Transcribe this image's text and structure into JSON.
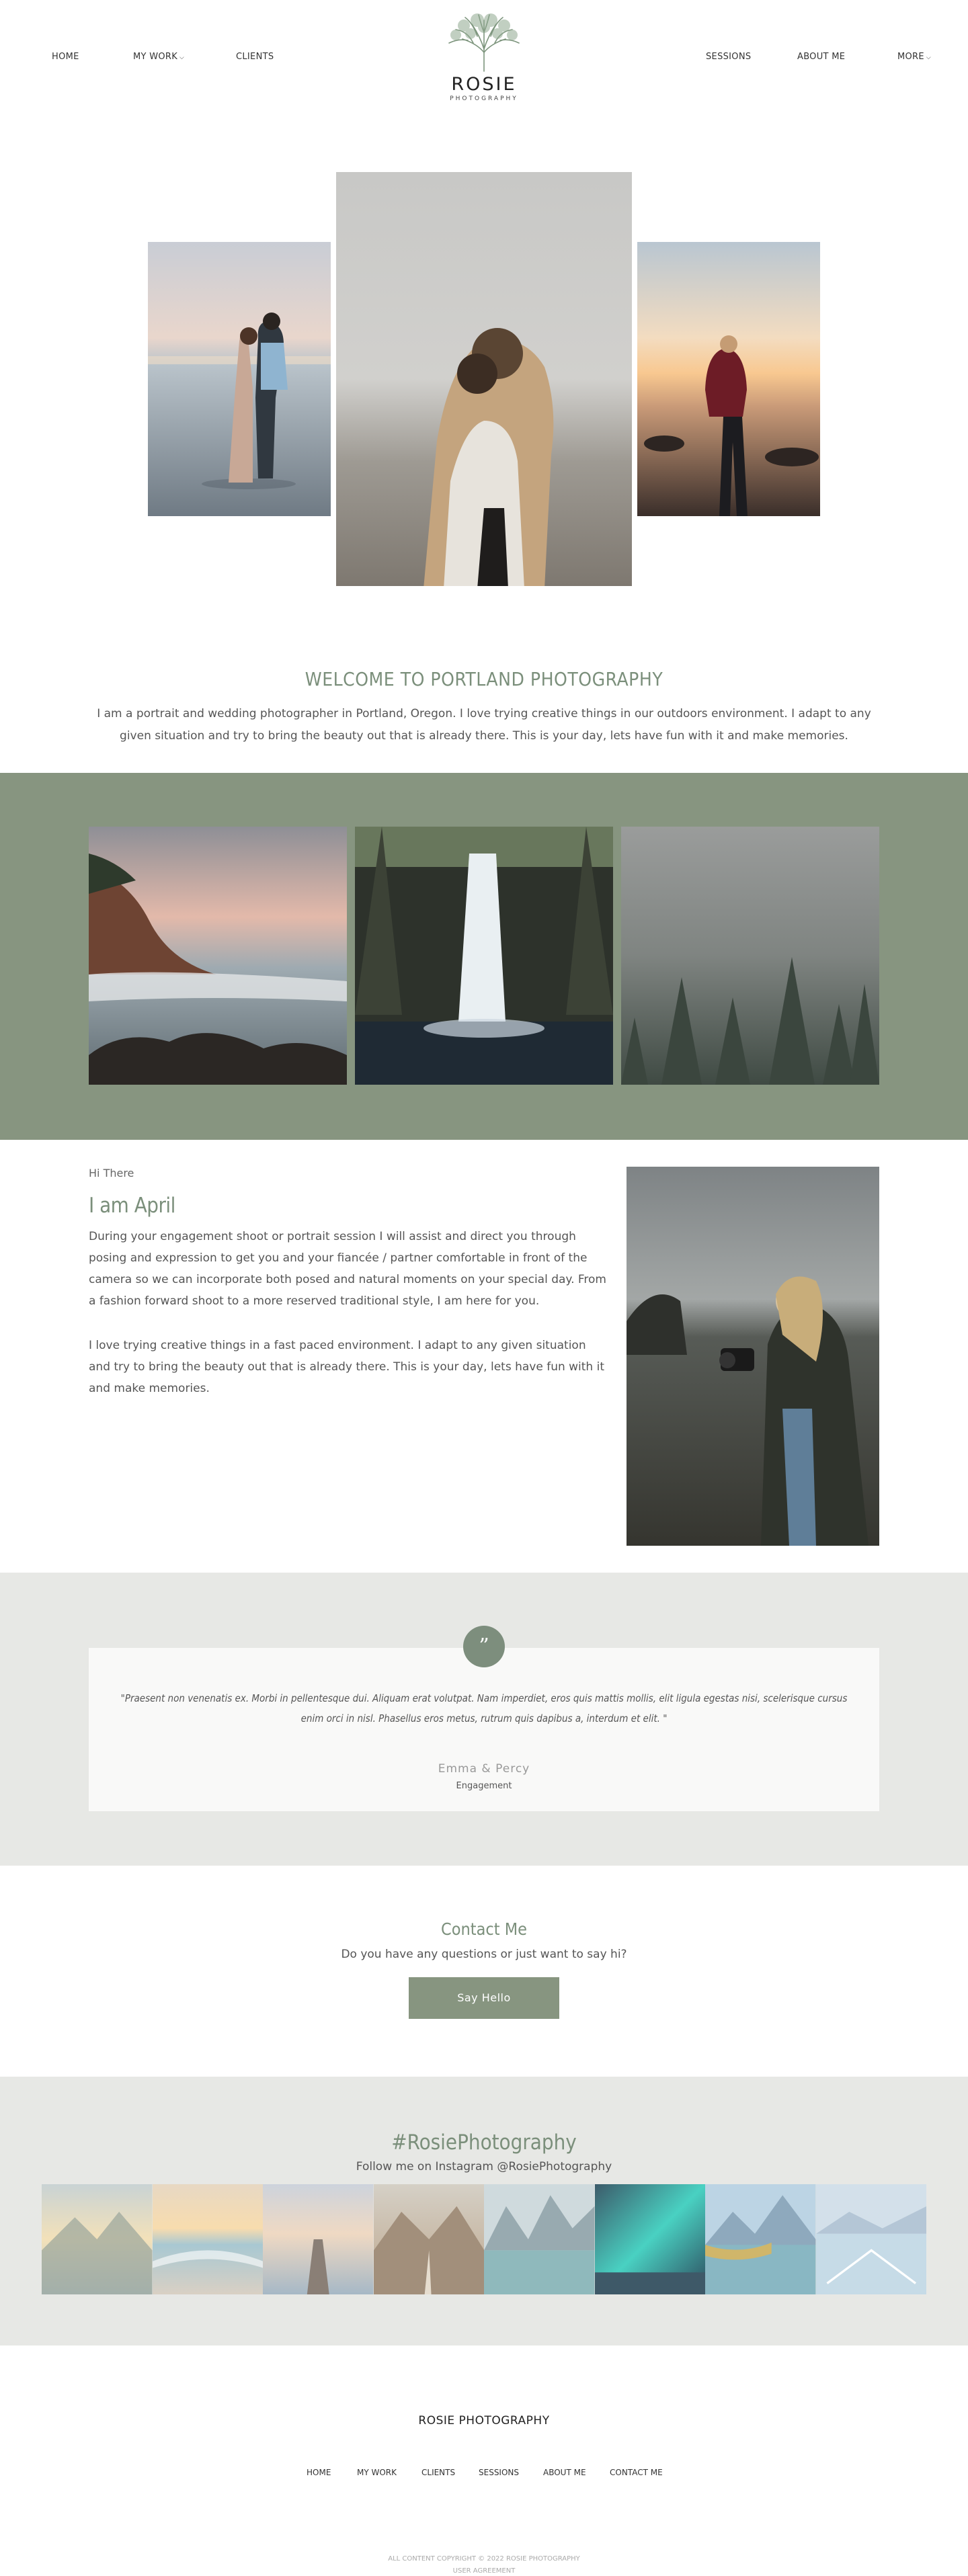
{
  "header": {
    "nav_left": [
      {
        "label": "HOME",
        "caret": false
      },
      {
        "label": "MY WORK",
        "caret": true
      },
      {
        "label": "CLIENTS",
        "caret": false
      }
    ],
    "nav_right": [
      {
        "label": "SESSIONS",
        "caret": false
      },
      {
        "label": "ABOUT ME",
        "caret": false
      },
      {
        "label": "MORE",
        "caret": true
      }
    ],
    "logo_title": "ROSIE",
    "logo_subtitle": "PHOTOGRAPHY"
  },
  "welcome": {
    "title": "WELCOME TO PORTLAND PHOTOGRAPHY",
    "text": "I am a portrait and wedding photographer in Portland, Oregon. I love trying creative things in our outdoors environment. I adapt to any given situation and try to bring the beauty out that is already there. This is your day, lets have fun with it and make memories."
  },
  "about": {
    "greeting": "Hi There",
    "title": "I am April",
    "paragraph1": "During your engagement shoot or portrait session I will assist and direct you through posing and expression to get you and your fiancée / partner comfortable in front of the camera so we can incorporate both posed and natural moments on your special day. From a fashion forward shoot to a more reserved traditional style, I am here for you.",
    "paragraph2": "I love trying creative things in a fast paced environment. I adapt to any given situation and try to bring the beauty out that is already there. This is your day, lets have fun with it and make memories."
  },
  "testimonial": {
    "quote": "\"Praesent non venenatis ex. Morbi in pellentesque dui. Aliquam erat volutpat. Nam imperdiet, eros quis mattis mollis, elit ligula egestas nisi, scelerisque cursus enim orci in nisl. Phasellus eros metus, rutrum quis dapibus a, interdum et elit. \"",
    "name": "Emma & Percy",
    "role": "Engagement",
    "icon": "quote-icon"
  },
  "contact": {
    "title": "Contact Me",
    "text": "Do you have any questions or just want to say hi?",
    "button": "Say Hello"
  },
  "instagram": {
    "title": "#RosiePhotography",
    "text": "Follow me on Instagram @RosiePhotography"
  },
  "footer": {
    "brand": "ROSIE PHOTOGRAPHY",
    "nav": [
      "HOME",
      "MY WORK",
      "CLIENTS",
      "SESSIONS",
      "ABOUT ME",
      "CONTACT ME"
    ],
    "copyright": "ALL CONTENT COPYRIGHT © 2022 ROSIE PHOTOGRAPHY",
    "user_agreement": "USER AGREEMENT"
  },
  "colors": {
    "accent_green": "#879580",
    "heading_green": "#7b8f7b",
    "light_gray_band": "#e7e8e5"
  }
}
